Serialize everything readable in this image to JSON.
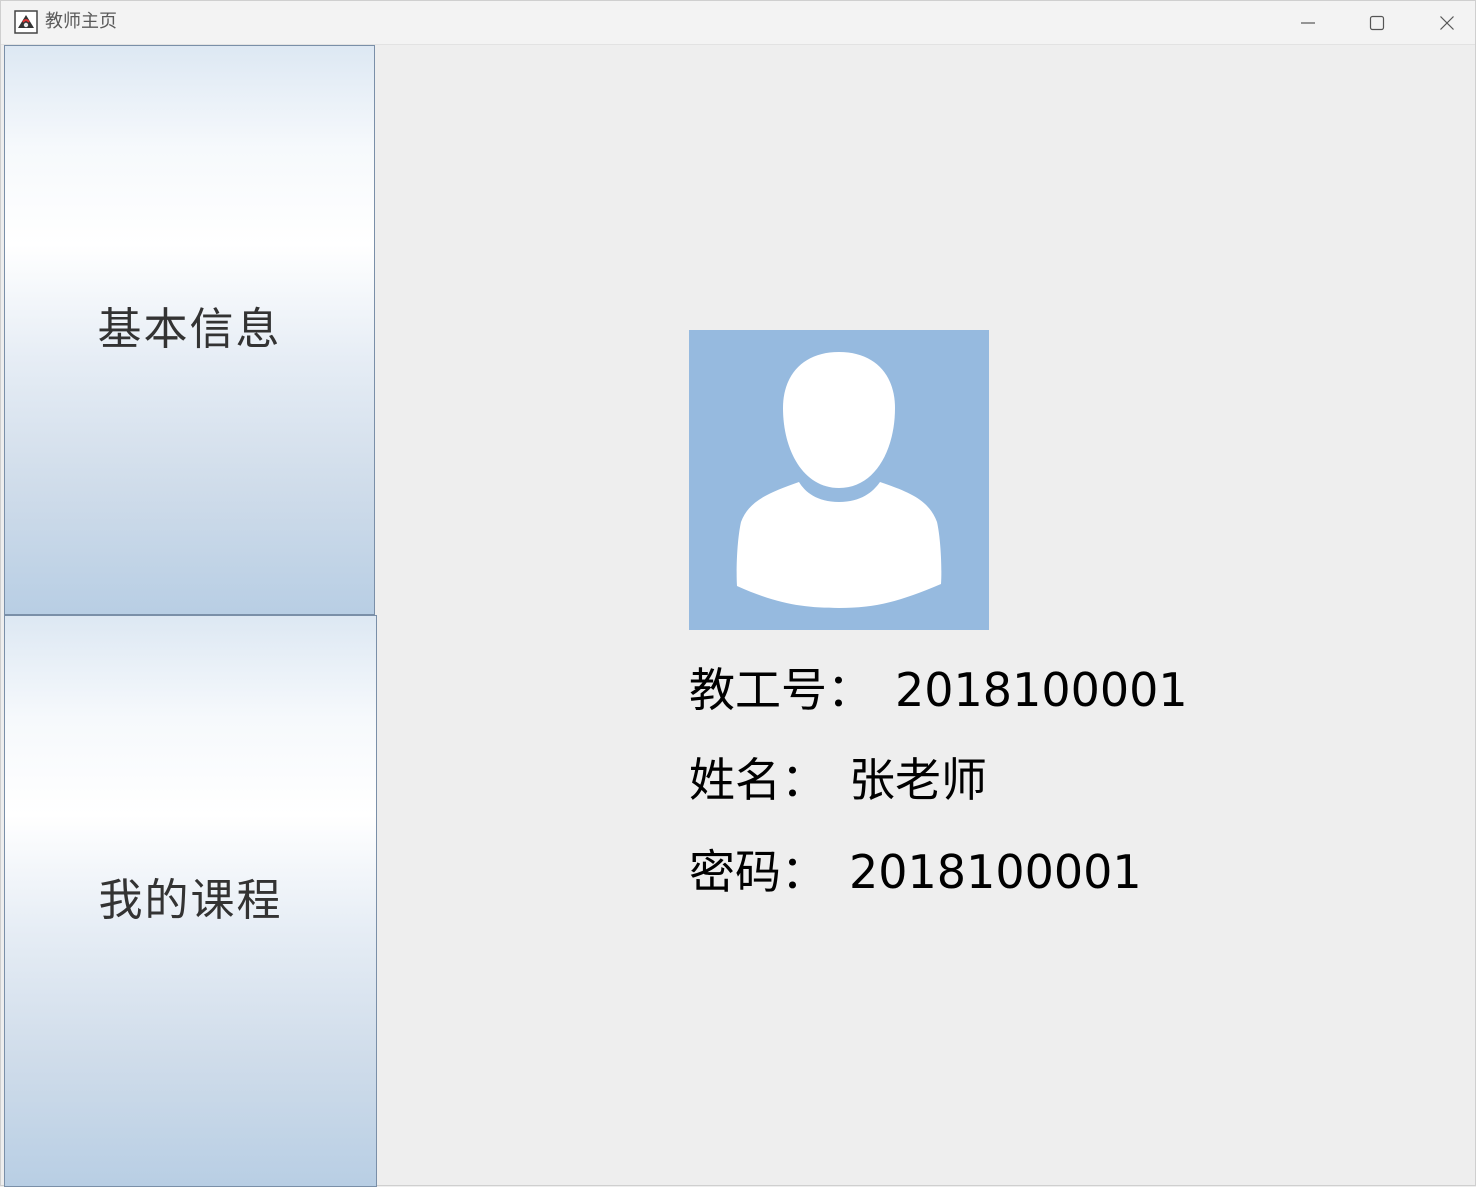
{
  "window": {
    "title": "教师主页",
    "icons": {
      "app": "java-app-icon",
      "minimize": "minimize-icon",
      "maximize": "maximize-icon",
      "close": "close-icon"
    }
  },
  "sidebar": {
    "items": [
      {
        "label": "基本信息"
      },
      {
        "label": "我的课程"
      }
    ]
  },
  "profile": {
    "avatar_icon": "user-avatar-icon",
    "id_label": "教工号：",
    "id_value": "2018100001",
    "name_label": "姓名：",
    "name_value": "张老师",
    "password_label": "密码：",
    "password_value": "2018100001"
  },
  "colors": {
    "avatar_bg": "#96badf",
    "window_bg": "#eeeeee",
    "button_gradient_top": "#dde8f3",
    "button_gradient_bottom": "#b8cee4"
  }
}
